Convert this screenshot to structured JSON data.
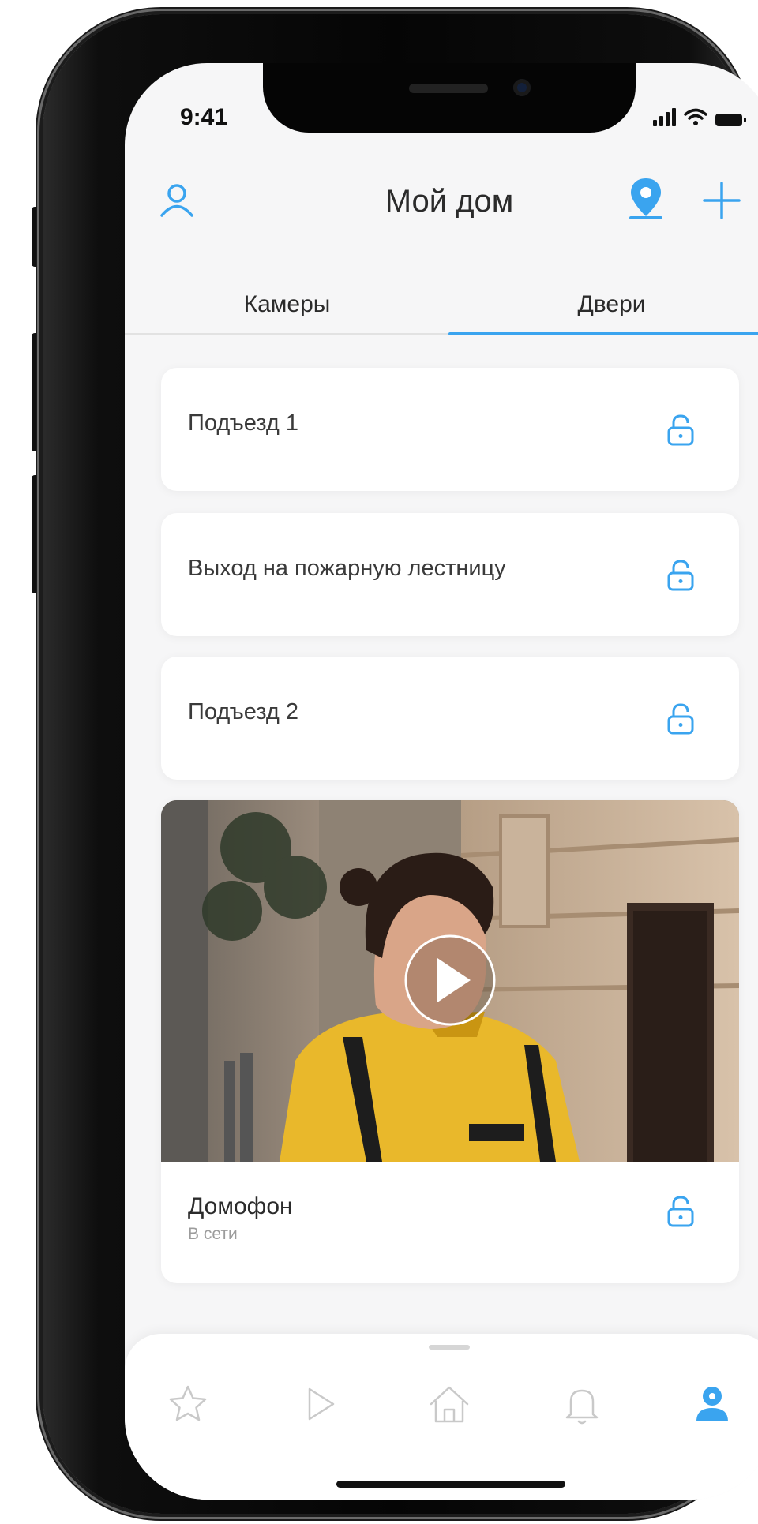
{
  "status_bar": {
    "time": "9:41"
  },
  "header": {
    "title": "Мой дом"
  },
  "tabs": [
    {
      "label": "Камеры",
      "active": false
    },
    {
      "label": "Двери",
      "active": true
    }
  ],
  "doors": [
    {
      "name": "Подъезд 1",
      "icon": "lock-icon"
    },
    {
      "name": "Выход на пожарную лестницу",
      "icon": "lock-icon"
    },
    {
      "name": "Подъезд 2",
      "icon": "lock-icon"
    }
  ],
  "intercom": {
    "name": "Домофон",
    "status": "В сети",
    "icon": "lock-icon",
    "video_icon": "play-icon"
  },
  "bottom_nav": [
    {
      "id": "favorites",
      "icon": "star-icon"
    },
    {
      "id": "video",
      "icon": "play-icon"
    },
    {
      "id": "home",
      "icon": "home-icon"
    },
    {
      "id": "notifications",
      "icon": "bell-icon"
    },
    {
      "id": "profile",
      "icon": "user-icon",
      "active": true
    }
  ],
  "colors": {
    "accent": "#3aa4ef",
    "inactive_icon": "#c9c9c9",
    "text": "#2b2b2b",
    "muted": "#9c9c9c"
  }
}
